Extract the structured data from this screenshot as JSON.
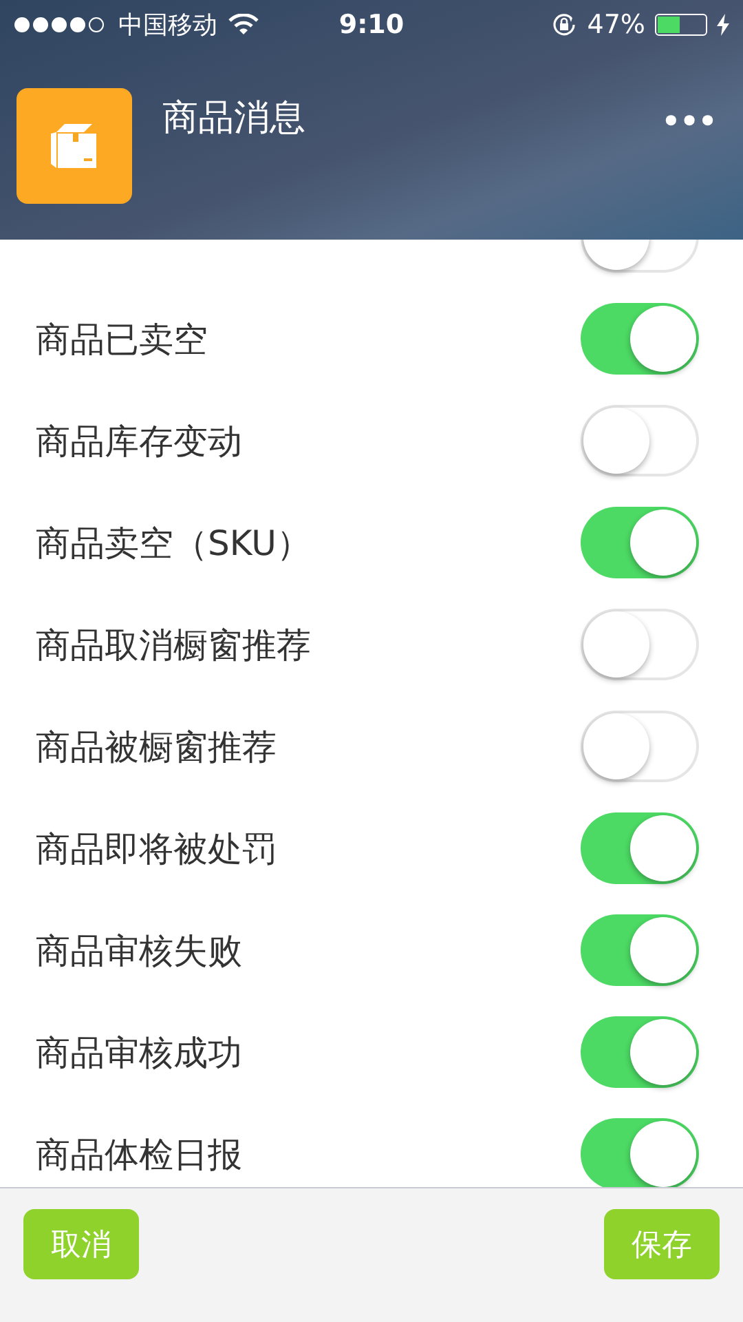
{
  "status_bar": {
    "carrier": "中国移动",
    "time": "9:10",
    "battery_percent": "47%",
    "charging": true
  },
  "header": {
    "title": "商品消息",
    "menu": "•••"
  },
  "partial_row": {
    "on": false
  },
  "rows": [
    {
      "label": "商品已卖空",
      "on": true
    },
    {
      "label": "商品库存变动",
      "on": false
    },
    {
      "label": "商品卖空（SKU）",
      "on": true
    },
    {
      "label": "商品取消橱窗推荐",
      "on": false
    },
    {
      "label": "商品被橱窗推荐",
      "on": false
    },
    {
      "label": "商品即将被处罚",
      "on": true
    },
    {
      "label": "商品审核失败",
      "on": true
    },
    {
      "label": "商品审核成功",
      "on": true
    },
    {
      "label": "商品体检日报",
      "on": true
    }
  ],
  "footer": {
    "cancel": "取消",
    "save": "保存"
  }
}
